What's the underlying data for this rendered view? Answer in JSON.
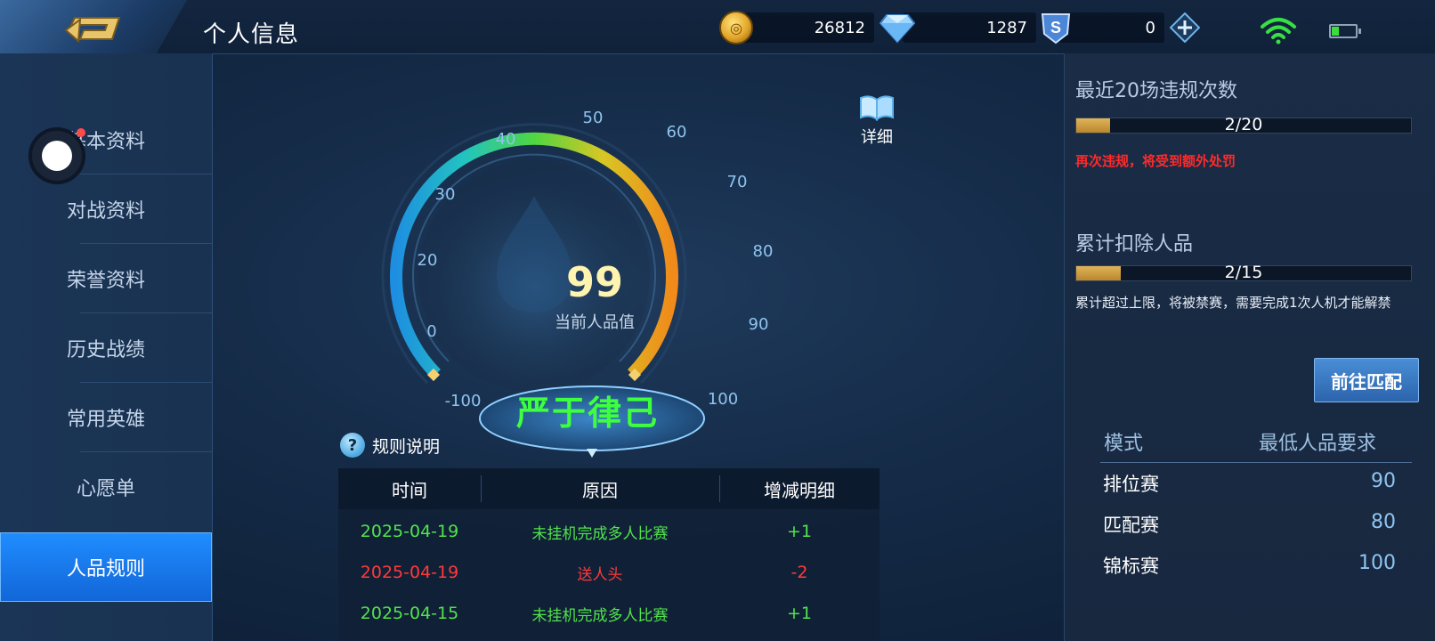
{
  "header": {
    "title": "个人信息",
    "coins": "26812",
    "diamonds": "1287",
    "vouchers": "0"
  },
  "sidebar": {
    "items": [
      {
        "label": "基本资料"
      },
      {
        "label": "对战资料"
      },
      {
        "label": "荣誉资料"
      },
      {
        "label": "历史战绩"
      },
      {
        "label": "常用英雄"
      },
      {
        "label": "心愿单"
      },
      {
        "label": "人品规则",
        "active": true
      }
    ]
  },
  "gauge": {
    "value": "99",
    "caption": "当前人品值",
    "ticks": [
      "-100",
      "0",
      "20",
      "30",
      "40",
      "50",
      "60",
      "70",
      "80",
      "90",
      "100"
    ],
    "grade": "严于律己",
    "detail_label": "详细"
  },
  "rules": {
    "label": "规则说明",
    "columns": [
      "时间",
      "原因",
      "增减明细"
    ],
    "rows": [
      {
        "time": "2025-04-19",
        "reason": "未挂机完成多人比赛",
        "delta": "+1",
        "kind": "pos"
      },
      {
        "time": "2025-04-19",
        "reason": "送人头",
        "delta": "-2",
        "kind": "neg"
      },
      {
        "time": "2025-04-15",
        "reason": "未挂机完成多人比赛",
        "delta": "+1",
        "kind": "pos"
      }
    ]
  },
  "violations": {
    "title": "最近20场违规次数",
    "current": 2,
    "max": 20,
    "text": "2/20",
    "warning": "再次违规，将受到额外处罚"
  },
  "deduction": {
    "title": "累计扣除人品",
    "current": 2,
    "max": 15,
    "text": "2/15",
    "info": "累计超过上限，将被禁赛，需要完成1次人机才能解禁"
  },
  "match_button": "前往匹配",
  "modes": {
    "col_mode": "模式",
    "col_req": "最低人品要求",
    "rows": [
      {
        "name": "排位赛",
        "value": "90"
      },
      {
        "name": "匹配赛",
        "value": "80"
      },
      {
        "name": "锦标赛",
        "value": "100"
      }
    ]
  },
  "colors": {
    "accent_blue": "#1f8dff",
    "positive": "#52e34c",
    "negative": "#ff3a3a",
    "grade_green": "#3dff3d",
    "progress_gold": "#c99638"
  }
}
